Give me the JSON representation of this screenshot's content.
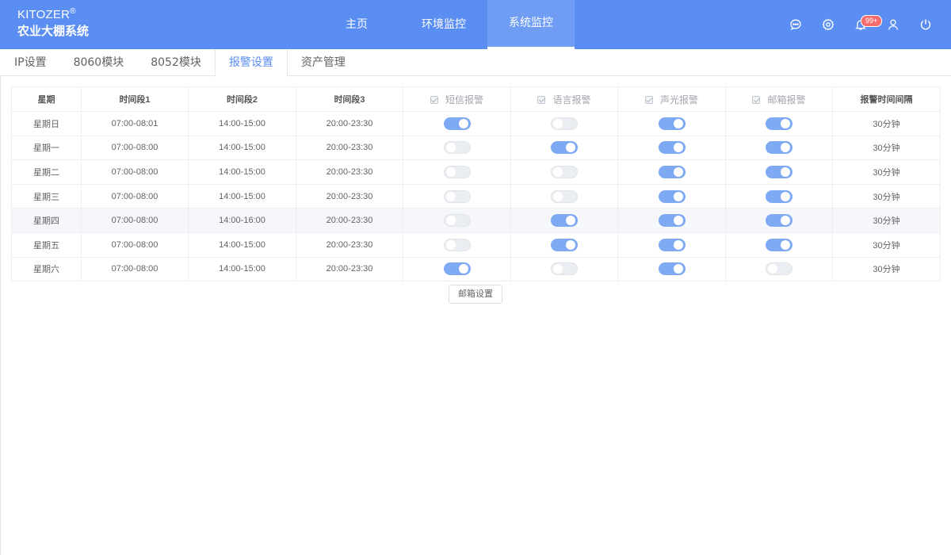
{
  "brand": {
    "name": "KITOZER",
    "reg": "®",
    "subtitle": "农业大棚系统"
  },
  "nav": [
    {
      "label": "主页",
      "active": false
    },
    {
      "label": "环境监控",
      "active": false
    },
    {
      "label": "系统监控",
      "active": true
    }
  ],
  "top_icons": {
    "message": "message-icon",
    "settings": "gear-icon",
    "bell": "bell-icon",
    "badge": "99+",
    "user": "user-icon",
    "power": "power-icon"
  },
  "subtabs": [
    {
      "label": "IP设置",
      "active": false
    },
    {
      "label": "8060模块",
      "active": false
    },
    {
      "label": "8052模块",
      "active": false
    },
    {
      "label": "报警设置",
      "active": true
    },
    {
      "label": "资产管理",
      "active": false
    }
  ],
  "table": {
    "headers": {
      "day": "星期",
      "period1": "时间段1",
      "period2": "时间段2",
      "period3": "时间段3",
      "sms": "短信报警",
      "voice": "语言报警",
      "light": "声光报警",
      "email": "邮箱报警",
      "interval": "报警时间间隔"
    },
    "rows": [
      {
        "day": "星期日",
        "p1": "07:00-08:01",
        "p2": "14:00-15:00",
        "p3": "20:00-23:30",
        "sms": true,
        "voice": false,
        "light": true,
        "email": true,
        "interval": "30分钟"
      },
      {
        "day": "星期一",
        "p1": "07:00-08:00",
        "p2": "14:00-15:00",
        "p3": "20:00-23:30",
        "sms": false,
        "voice": true,
        "light": true,
        "email": true,
        "interval": "30分钟"
      },
      {
        "day": "星期二",
        "p1": "07:00-08:00",
        "p2": "14:00-15:00",
        "p3": "20:00-23:30",
        "sms": false,
        "voice": false,
        "light": true,
        "email": true,
        "interval": "30分钟"
      },
      {
        "day": "星期三",
        "p1": "07:00-08:00",
        "p2": "14:00-15:00",
        "p3": "20:00-23:30",
        "sms": false,
        "voice": false,
        "light": true,
        "email": true,
        "interval": "30分钟"
      },
      {
        "day": "星期四",
        "p1": "07:00-08:00",
        "p2": "14:00-16:00",
        "p3": "20:00-23:30",
        "sms": false,
        "voice": true,
        "light": true,
        "email": true,
        "interval": "30分钟",
        "highlight": true
      },
      {
        "day": "星期五",
        "p1": "07:00-08:00",
        "p2": "14:00-15:00",
        "p3": "20:00-23:30",
        "sms": false,
        "voice": true,
        "light": true,
        "email": true,
        "interval": "30分钟"
      },
      {
        "day": "星期六",
        "p1": "07:00-08:00",
        "p2": "14:00-15:00",
        "p3": "20:00-23:30",
        "sms": true,
        "voice": false,
        "light": true,
        "email": false,
        "interval": "30分钟"
      }
    ]
  },
  "mail_button": "邮箱设置",
  "colors": {
    "header_bg": "#5b8ef2",
    "switch_on": "#7eaaf4",
    "badge": "#f56c6c"
  }
}
